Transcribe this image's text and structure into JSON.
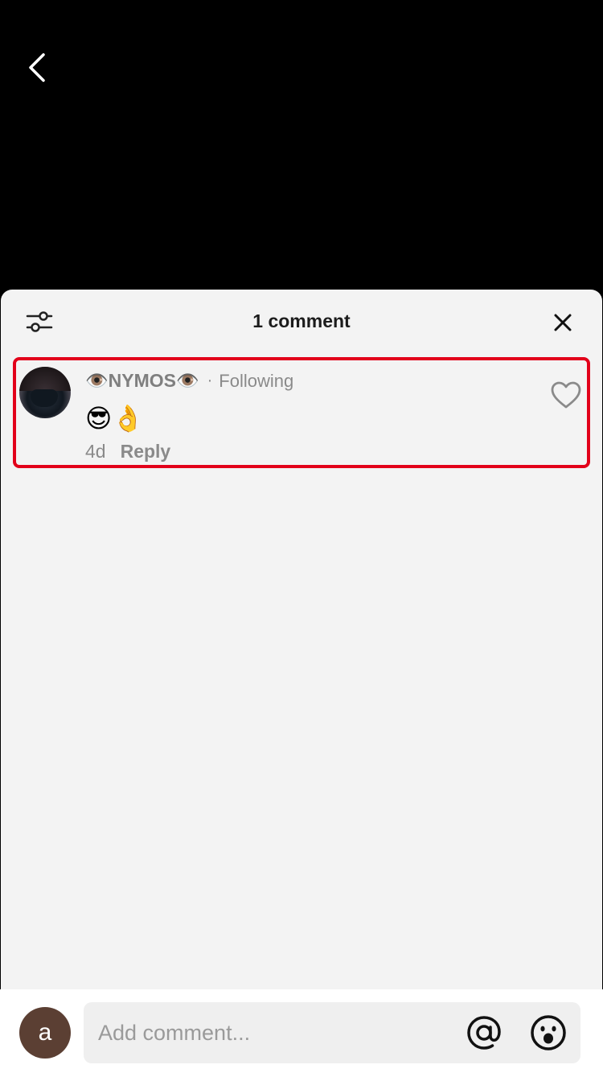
{
  "header": {
    "title": "1 comment"
  },
  "comment": {
    "username": "👁️NYMOS👁️",
    "separator": "·",
    "following_label": "Following",
    "text": "😎👌",
    "time": "4d",
    "reply_label": "Reply"
  },
  "composer": {
    "avatar_letter": "a",
    "placeholder": "Add comment..."
  },
  "colors": {
    "highlight_border": "#e2001a",
    "sheet_background": "#f3f3f3",
    "avatar_background": "#5b3f33"
  },
  "icons": [
    "back-chevron-icon",
    "filter-sliders-icon",
    "close-icon",
    "heart-outline-icon",
    "at-sign-icon",
    "emoji-face-icon"
  ]
}
